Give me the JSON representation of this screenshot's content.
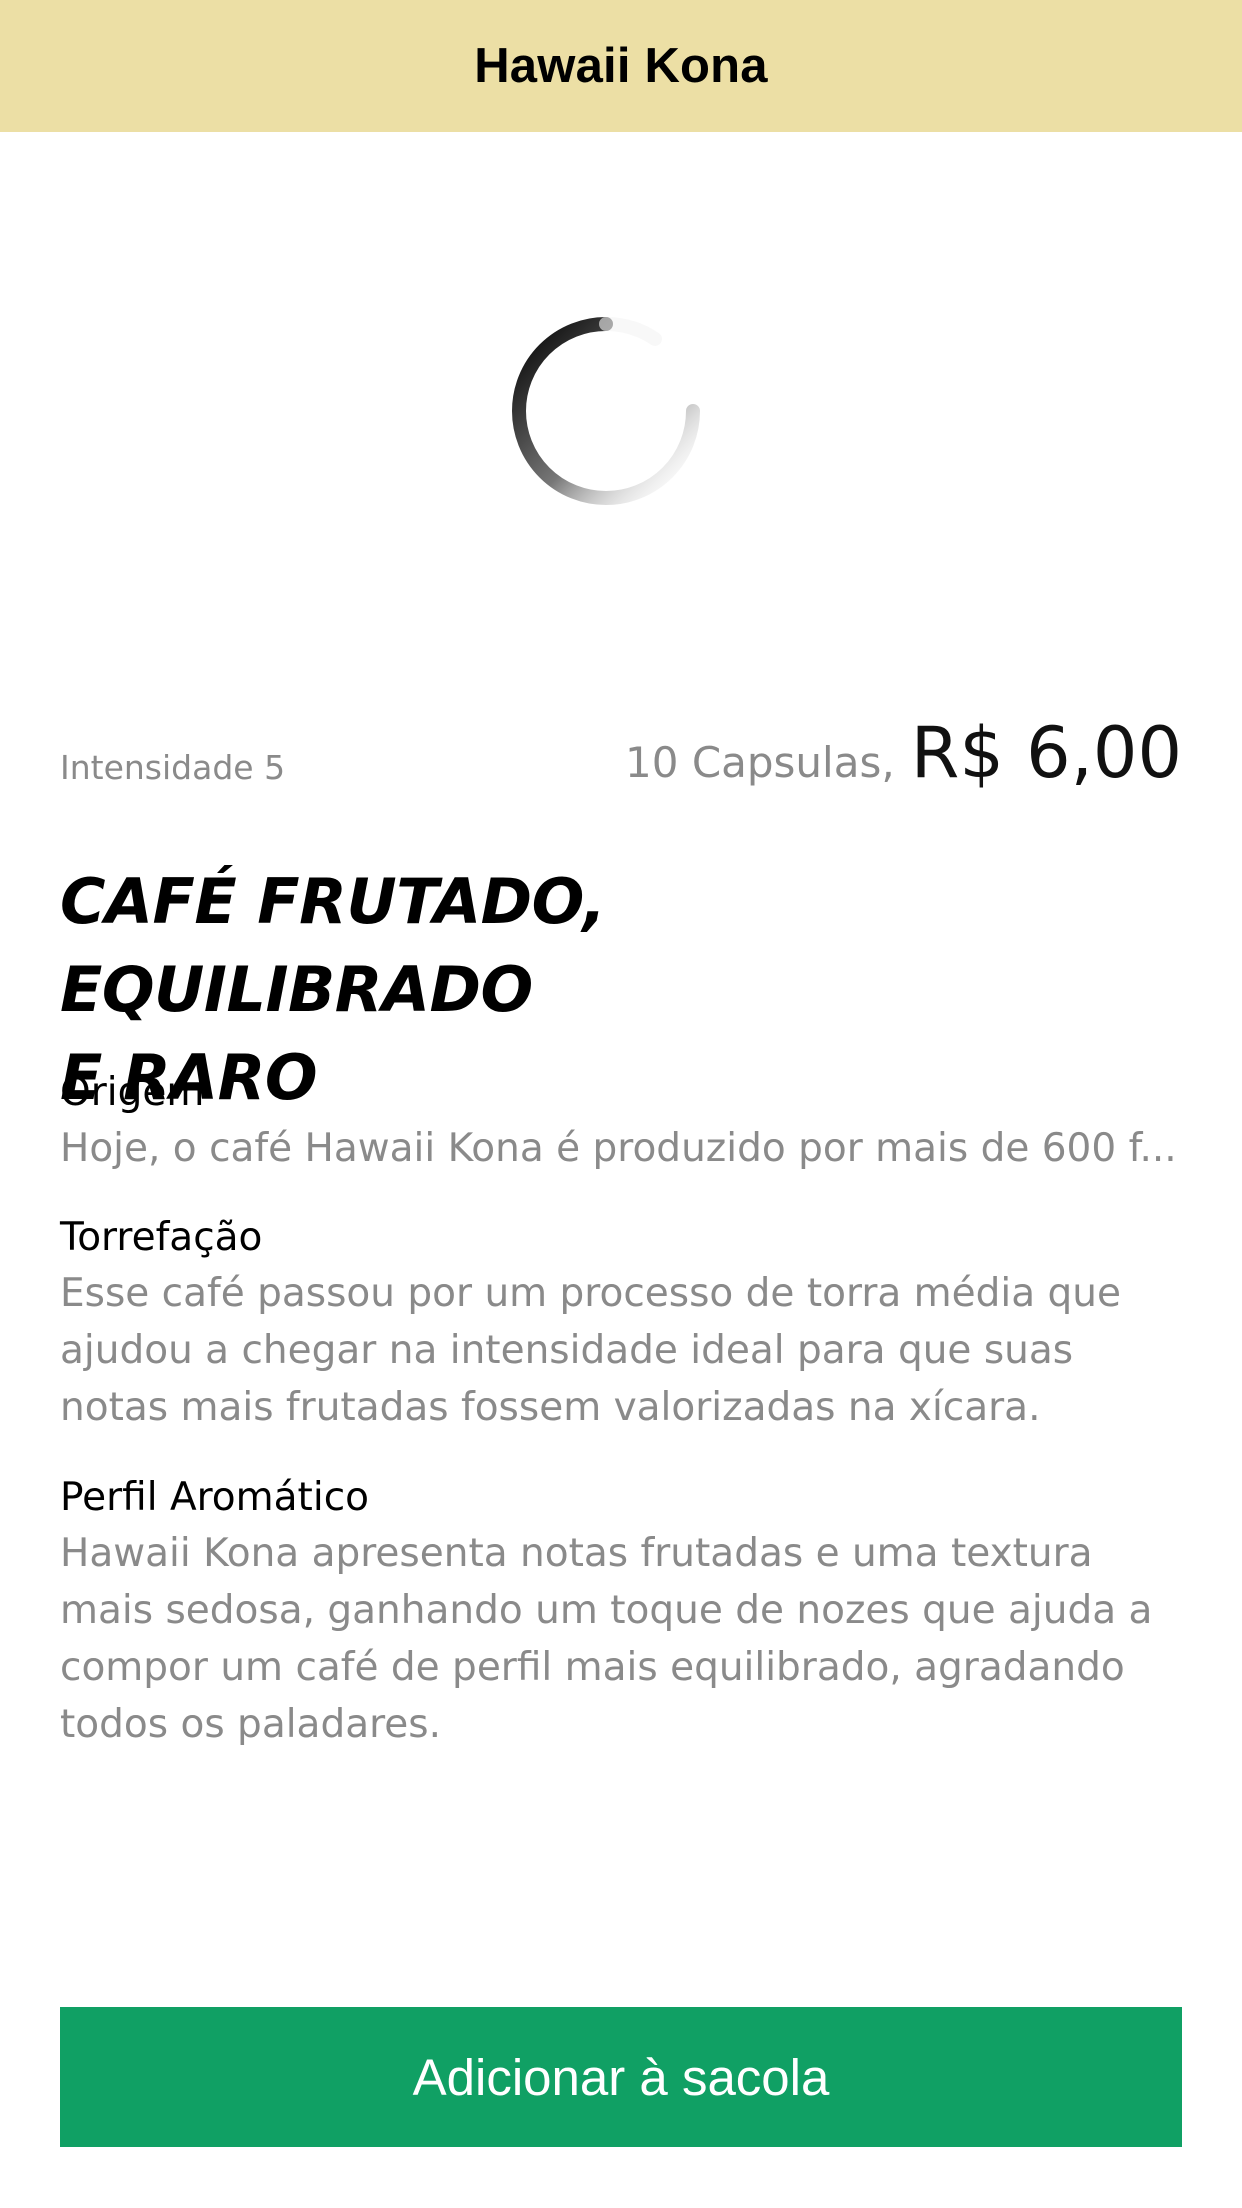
{
  "colors": {
    "header_bg": "#ECDFA5",
    "accent": "#10A064",
    "muted_text": "#8A8A8A"
  },
  "header": {
    "title": "Hawaii Kona"
  },
  "image_area": {
    "icon": "loading-spinner-icon"
  },
  "product": {
    "intensity": "Intensidade 5",
    "capsules": "10 Capsulas,",
    "price": "R$ 6,00",
    "headline_line1": "CAFÉ FRUTADO, EQUILIBRADO",
    "headline_line2": "E RARO"
  },
  "sections": [
    {
      "title": "Origem",
      "text": "Hoje, o café Hawaii Kona é produzido por mais de 600 f..."
    },
    {
      "title": "Torrefação",
      "text": "Esse café passou por um processo de torra média que ajudou a chegar na intensidade ideal para que suas notas mais frutadas fossem valorizadas na xícara."
    },
    {
      "title": "Perfil Aromático",
      "text": "Hawaii Kona apresenta notas frutadas e uma textura mais sedosa, ganhando um toque de nozes que ajuda a compor um café de perfil mais equilibrado, agradando todos os paladares."
    }
  ],
  "actions": {
    "add_to_bag_label": "Adicionar à sacola"
  }
}
